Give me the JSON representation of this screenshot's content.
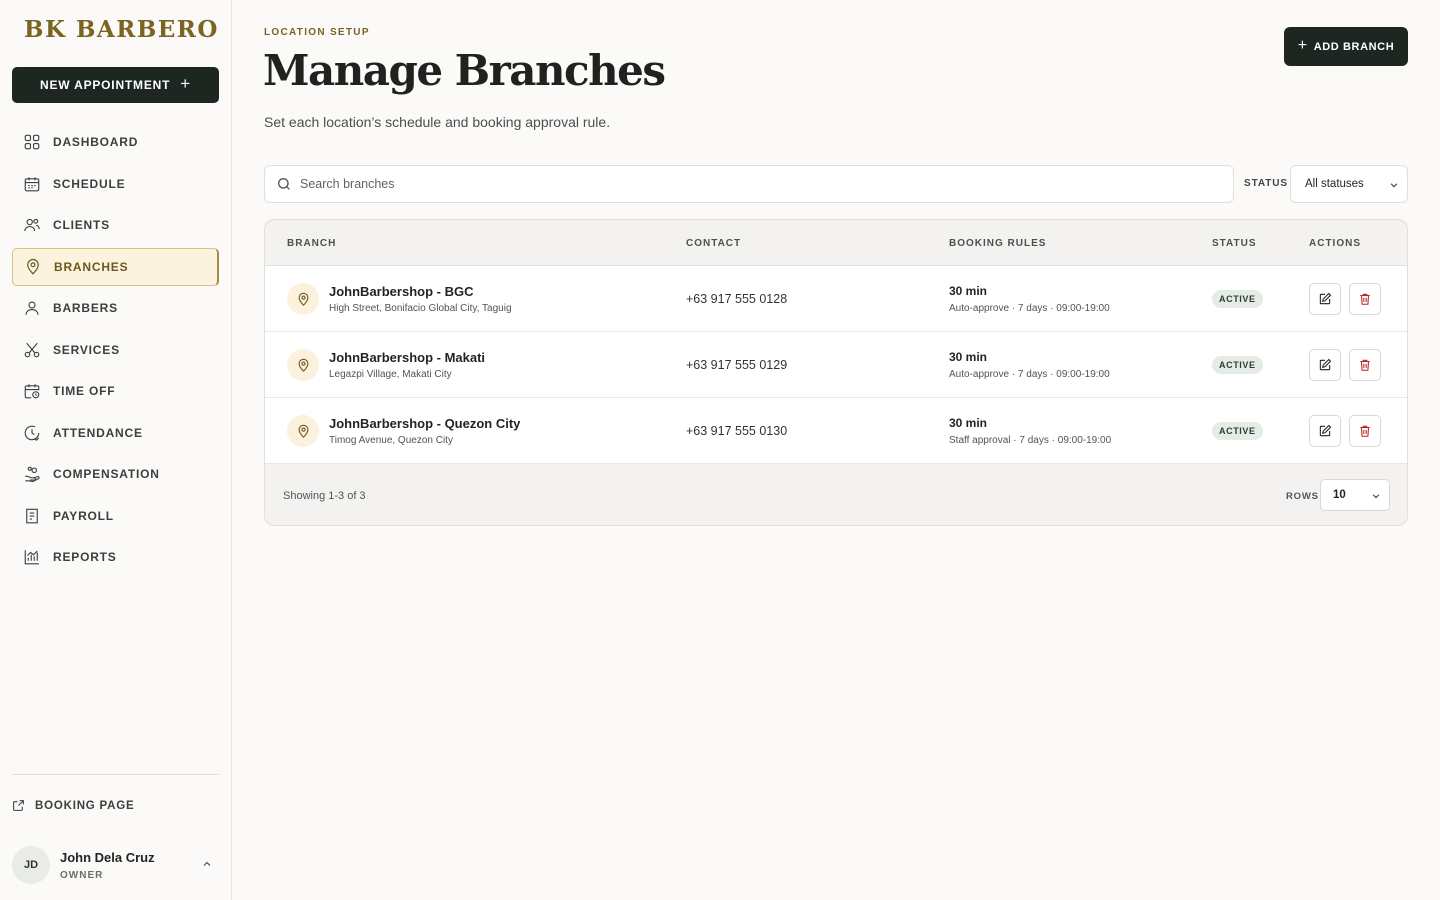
{
  "brand": "BK BARBERO",
  "new_appointment_label": "NEW APPOINTMENT",
  "nav": [
    {
      "label": "DASHBOARD",
      "icon": "grid-icon"
    },
    {
      "label": "SCHEDULE",
      "icon": "calendar-icon"
    },
    {
      "label": "CLIENTS",
      "icon": "users-icon"
    },
    {
      "label": "BRANCHES",
      "icon": "map-pin-icon",
      "active": true
    },
    {
      "label": "BARBERS",
      "icon": "user-icon"
    },
    {
      "label": "SERVICES",
      "icon": "scissors-icon"
    },
    {
      "label": "TIME OFF",
      "icon": "calendar-clock-icon"
    },
    {
      "label": "ATTENDANCE",
      "icon": "clock-check-icon"
    },
    {
      "label": "COMPENSATION",
      "icon": "hand-coins-icon"
    },
    {
      "label": "PAYROLL",
      "icon": "receipt-icon"
    },
    {
      "label": "REPORTS",
      "icon": "bar-chart-icon"
    }
  ],
  "booking_page_label": "BOOKING PAGE",
  "user": {
    "initials": "JD",
    "name": "John Dela Cruz",
    "role": "OWNER"
  },
  "header": {
    "eyebrow": "LOCATION SETUP",
    "title": "Manage Branches",
    "subtitle": "Set each location’s schedule and booking approval rule.",
    "add_branch_label": "ADD BRANCH"
  },
  "filters": {
    "search_placeholder": "Search branches",
    "status_label": "STATUS",
    "status_value": "All statuses"
  },
  "table": {
    "headers": {
      "branch": "BRANCH",
      "contact": "CONTACT",
      "booking_rules": "BOOKING RULES",
      "status": "STATUS",
      "actions": "ACTIONS"
    },
    "rows": [
      {
        "name": "JohnBarbershop - BGC",
        "address": "High Street, Bonifacio Global City, Taguig",
        "contact": "+63 917 555 0128",
        "duration": "30 min",
        "rule": "Auto-approve · 7 days · 09:00-19:00",
        "status": "ACTIVE"
      },
      {
        "name": "JohnBarbershop - Makati",
        "address": "Legazpi Village, Makati City",
        "contact": "+63 917 555 0129",
        "duration": "30 min",
        "rule": "Auto-approve · 7 days · 09:00-19:00",
        "status": "ACTIVE"
      },
      {
        "name": "JohnBarbershop - Quezon City",
        "address": "Timog Avenue, Quezon City",
        "contact": "+63 917 555 0130",
        "duration": "30 min",
        "rule": "Staff approval · 7 days · 09:00-19:00",
        "status": "ACTIVE"
      }
    ],
    "footer": {
      "showing": "Showing 1-3 of 3",
      "rows_label": "ROWS",
      "rows_value": "10"
    }
  },
  "colors": {
    "accent": "#7a6422",
    "dark_button": "#1e2622",
    "active_nav_bg": "#fcf3df",
    "badge_bg": "#e5ece6",
    "delete_red": "#b3261e"
  }
}
